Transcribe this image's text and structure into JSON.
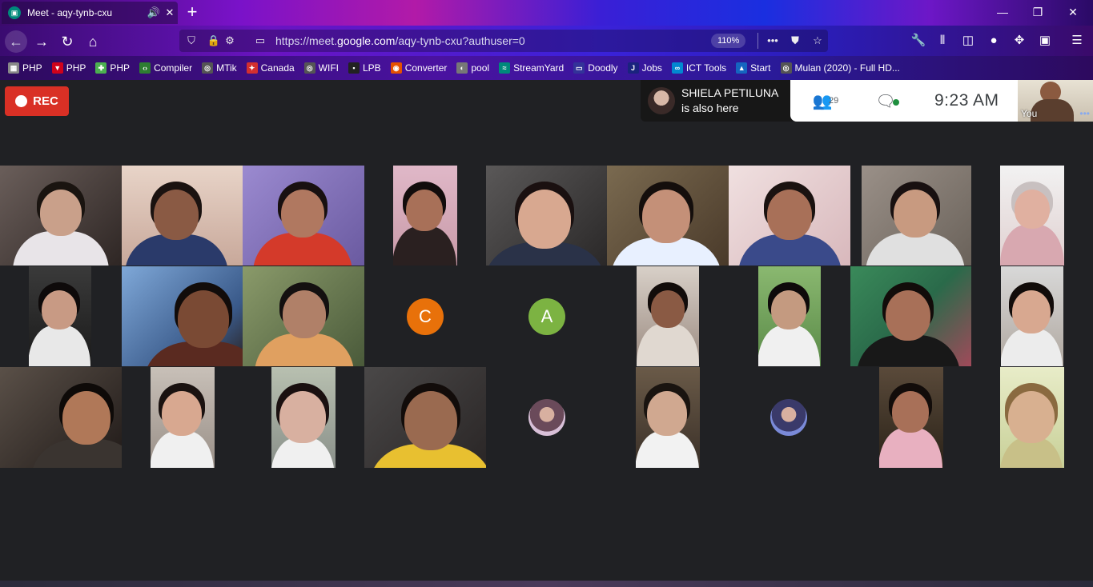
{
  "browser": {
    "tab_title": "Meet - aqy-tynb-cxu",
    "url_prefix": "https://meet.",
    "url_domain": "google.com",
    "url_suffix": "/aqy-tynb-cxu?authuser=0",
    "zoom": "110%"
  },
  "bookmarks": [
    {
      "label": "PHP",
      "icon": "php-icon",
      "color": "#888888"
    },
    {
      "label": "PHP",
      "icon": "php-red-icon",
      "color": "#d0021b"
    },
    {
      "label": "PHP",
      "icon": "php-green-icon",
      "color": "#4caf50"
    },
    {
      "label": "Compiler",
      "icon": "code-icon",
      "color": "#2e7d32"
    },
    {
      "label": "MTik",
      "icon": "globe-icon",
      "color": "#555555"
    },
    {
      "label": "Canada",
      "icon": "maple-leaf-icon",
      "color": "#d32f2f"
    },
    {
      "label": "WIFI",
      "icon": "globe-icon",
      "color": "#555555"
    },
    {
      "label": "LPB",
      "icon": "lpb-icon",
      "color": "#222222"
    },
    {
      "label": "Converter",
      "icon": "converter-icon",
      "color": "#e65100"
    },
    {
      "label": "pool",
      "icon": "pool-icon",
      "color": "#777777"
    },
    {
      "label": "StreamYard",
      "icon": "streamyard-icon",
      "color": "#00897b"
    },
    {
      "label": "Doodly",
      "icon": "doodly-icon",
      "color": "#333399"
    },
    {
      "label": "Jobs",
      "icon": "jobs-icon",
      "color": "#1a237e"
    },
    {
      "label": "ICT Tools",
      "icon": "ict-icon",
      "color": "#0288d1"
    },
    {
      "label": "Start",
      "icon": "start-icon",
      "color": "#1565c0"
    },
    {
      "label": "Mulan (2020) - Full HD...",
      "icon": "globe-icon",
      "color": "#555555"
    }
  ],
  "meet": {
    "rec_label": "REC",
    "toast_name": "SHIELA PETILUNA",
    "toast_text": "is also here",
    "participant_count": "29",
    "time": "9:23  AM",
    "self_label": "You",
    "letter_avatars": [
      {
        "letter": "C",
        "color": "#e8710a"
      },
      {
        "letter": "A",
        "color": "#7cb342"
      }
    ]
  },
  "colors": {
    "rec": "#d93025",
    "meet_bg": "#202124"
  }
}
